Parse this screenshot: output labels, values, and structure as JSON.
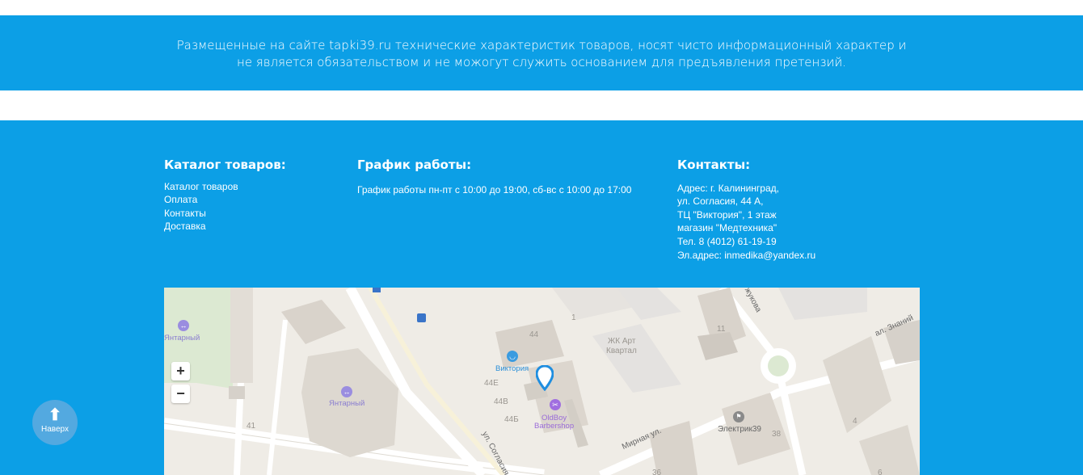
{
  "disclaimer": {
    "text": "Размещенные на сайте tapki39.ru технические характеристик товаров, носят чисто информационный характер и не является обязательством и не можогут служить основанием для предъявления претензий."
  },
  "catalog": {
    "title": "Каталог товаров:",
    "links": [
      "Каталог товаров",
      "Оплата",
      "Контакты",
      "Доставка"
    ]
  },
  "schedule": {
    "title": "График работы:",
    "text": "График работы пн-пт с 10:00 до 19:00, сб-вс с 10:00 до 17:00"
  },
  "contacts": {
    "title": "Контакты:",
    "lines": [
      "Адрес: г. Калининград,",
      "ул. Согласия, 44 А,",
      "ТЦ \"Виктория\", 1 этаж",
      "магазин \"Медтехника\"",
      "Тел. 8 (4012) 61-19-19"
    ],
    "email": "Эл.адрес: inmedika@yandex.ru"
  },
  "map": {
    "zoom_in": "+",
    "zoom_out": "−",
    "labels": {
      "yantarny_top": "Янтарный",
      "yantarny_center": "Янтарный",
      "viktoria": "Виктория",
      "oldboy_1": "OldBoy",
      "oldboy_2": "Barbershop",
      "zhk_1": "ЖК Арт",
      "zhk_2": "Квартал",
      "elektrik": "Электрик39",
      "mirnaya": "Мирная ул.",
      "soglasiya": "ул. Согласия",
      "znaniy": "ал. Знаний",
      "zhukova": "жукова",
      "n44": "44",
      "n44e": "44Е",
      "n44v": "44В",
      "n44b": "44Б",
      "n1": "1",
      "n11": "11",
      "n41": "41",
      "n38": "38",
      "n4": "4",
      "n36": "36",
      "n6": "6"
    }
  },
  "back_to_top": {
    "label": "Наверх"
  },
  "colors": {
    "brand_blue": "#0c9fe6",
    "map_bg": "#efece6",
    "poi_blue": "#2b8fd8",
    "poi_purple": "#9a6bd8"
  }
}
